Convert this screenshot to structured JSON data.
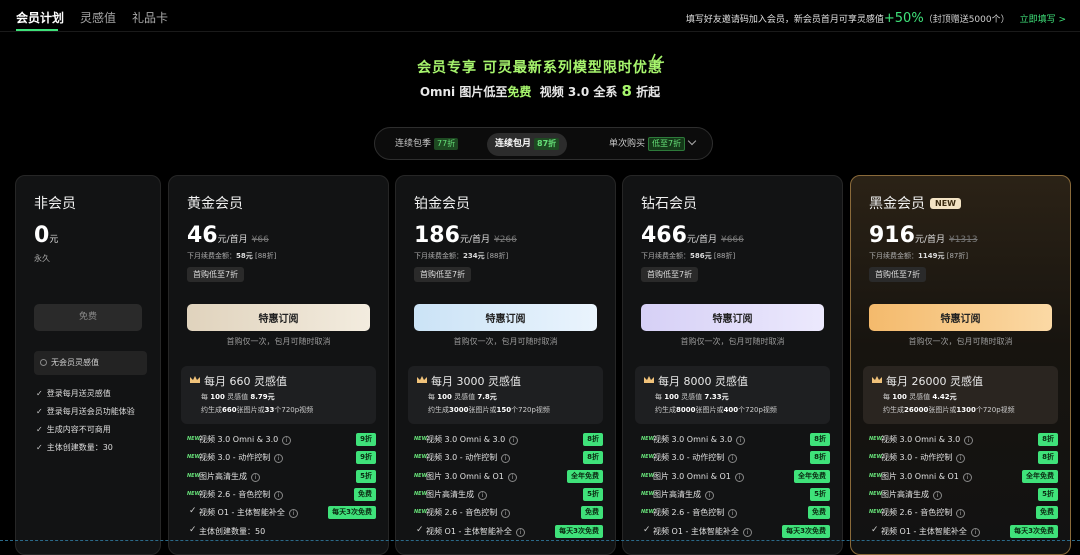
{
  "nav": {
    "tabs": [
      "会员计划",
      "灵感值",
      "礼品卡"
    ],
    "invite_text": "填写好友邀请码加入会员，新会员首月可享灵感值",
    "invite_bonus": "+50%",
    "invite_cap": "（封顶赠送5000个）",
    "invite_link": "立即填写 >"
  },
  "hero": {
    "line1": "会员专享 可灵最新系列模型限时优惠",
    "line2_a": "Omni 图片低至",
    "line2_free": "免费",
    "line2_b": "视频 3.0 全系",
    "line2_num": "8",
    "line2_c": "折起"
  },
  "billing": {
    "options": [
      {
        "label": "连续包季",
        "badge": "77折"
      },
      {
        "label": "连续包月",
        "badge": "87折"
      },
      {
        "label": "单次购买",
        "badge": "低至7折"
      }
    ],
    "selected_index": 1
  },
  "nonmember": {
    "name": "非会员",
    "price": "0",
    "unit": "元",
    "duration": "永久",
    "button": "免费",
    "credits": "无会员灵感值",
    "features": [
      "登录每月送灵感值",
      "登录每月送会员功能体验",
      "生成内容不可商用",
      "主体创建数量：30"
    ]
  },
  "plans": [
    {
      "name": "黄金会员",
      "new": "",
      "price": "46",
      "unit": "元/首月",
      "orig": "¥66",
      "renew_label": "下月续费金额：",
      "renew_price": "58元",
      "renew_disc": "[88折]",
      "first_tag": "首购低至7折",
      "cta": "特惠订阅",
      "cta_note": "首购仅一次，包月可随时取消",
      "credit_prefix": "每月",
      "credits": "660",
      "credit_unit": "灵感值",
      "per_price_a": "每",
      "per_price_b": "100",
      "per_price_c": "灵感值",
      "per_price_d": "8.79元",
      "gen_a": "约生成",
      "gen_imgs": "660",
      "gen_b": "张图片或",
      "gen_vids": "33",
      "gen_c": "个720p视频",
      "features": [
        {
          "new": "NEW",
          "label": "视频 3.0 Omni & 3.0",
          "info": "i",
          "badge": "9折"
        },
        {
          "new": "NEW",
          "label": "视频 3.0 - 动作控制",
          "info": "i",
          "badge": "9折"
        },
        {
          "new": "NEW",
          "label": "图片高清生成",
          "info": "i",
          "badge": "5折"
        },
        {
          "new": "NEW",
          "label": "视频 2.6 - 音色控制",
          "info": "i",
          "badge": "免费"
        },
        {
          "new": "",
          "label": "视频 O1 - 主体智能补全",
          "info": "i",
          "badge": "每天3次免费"
        },
        {
          "new": "",
          "label": "主体创建数量：50",
          "info": "",
          "badge": ""
        }
      ]
    },
    {
      "name": "铂金会员",
      "new": "",
      "price": "186",
      "unit": "元/首月",
      "orig": "¥266",
      "renew_label": "下月续费金额：",
      "renew_price": "234元",
      "renew_disc": "[88折]",
      "first_tag": "首购低至7折",
      "cta": "特惠订阅",
      "cta_note": "首购仅一次，包月可随时取消",
      "credit_prefix": "每月",
      "credits": "3000",
      "credit_unit": "灵感值",
      "per_price_a": "每",
      "per_price_b": "100",
      "per_price_c": "灵感值",
      "per_price_d": "7.8元",
      "gen_a": "约生成",
      "gen_imgs": "3000",
      "gen_b": "张图片或",
      "gen_vids": "150",
      "gen_c": "个720p视频",
      "features": [
        {
          "new": "NEW",
          "label": "视频 3.0 Omni & 3.0",
          "info": "i",
          "badge": "8折"
        },
        {
          "new": "NEW",
          "label": "视频 3.0 - 动作控制",
          "info": "i",
          "badge": "8折"
        },
        {
          "new": "NEW",
          "label": "图片 3.0 Omni & O1",
          "info": "i",
          "badge": "全年免费"
        },
        {
          "new": "NEW",
          "label": "图片高清生成",
          "info": "i",
          "badge": "5折"
        },
        {
          "new": "NEW",
          "label": "视频 2.6 - 音色控制",
          "info": "i",
          "badge": "免费"
        },
        {
          "new": "",
          "label": "视频 O1 - 主体智能补全",
          "info": "i",
          "badge": "每天3次免费"
        }
      ]
    },
    {
      "name": "钻石会员",
      "new": "",
      "price": "466",
      "unit": "元/首月",
      "orig": "¥666",
      "renew_label": "下月续费金额：",
      "renew_price": "586元",
      "renew_disc": "[88折]",
      "first_tag": "首购低至7折",
      "cta": "特惠订阅",
      "cta_note": "首购仅一次，包月可随时取消",
      "credit_prefix": "每月",
      "credits": "8000",
      "credit_unit": "灵感值",
      "per_price_a": "每",
      "per_price_b": "100",
      "per_price_c": "灵感值",
      "per_price_d": "7.33元",
      "gen_a": "约生成",
      "gen_imgs": "8000",
      "gen_b": "张图片或",
      "gen_vids": "400",
      "gen_c": "个720p视频",
      "features": [
        {
          "new": "NEW",
          "label": "视频 3.0 Omni & 3.0",
          "info": "i",
          "badge": "8折"
        },
        {
          "new": "NEW",
          "label": "视频 3.0 - 动作控制",
          "info": "i",
          "badge": "8折"
        },
        {
          "new": "NEW",
          "label": "图片 3.0 Omni & O1",
          "info": "i",
          "badge": "全年免费"
        },
        {
          "new": "NEW",
          "label": "图片高清生成",
          "info": "i",
          "badge": "5折"
        },
        {
          "new": "NEW",
          "label": "视频 2.6 - 音色控制",
          "info": "i",
          "badge": "免费"
        },
        {
          "new": "",
          "label": "视频 O1 - 主体智能补全",
          "info": "i",
          "badge": "每天3次免费"
        }
      ]
    },
    {
      "name": "黑金会员",
      "new": "NEW",
      "price": "916",
      "unit": "元/首月",
      "orig": "¥1313",
      "renew_label": "下月续费金额：",
      "renew_price": "1149元",
      "renew_disc": "[87折]",
      "first_tag": "首购低至7折",
      "cta": "特惠订阅",
      "cta_note": "首购仅一次，包月可随时取消",
      "credit_prefix": "每月",
      "credits": "26000",
      "credit_unit": "灵感值",
      "per_price_a": "每",
      "per_price_b": "100",
      "per_price_c": "灵感值",
      "per_price_d": "4.42元",
      "gen_a": "约生成",
      "gen_imgs": "26000",
      "gen_b": "张图片或",
      "gen_vids": "1300",
      "gen_c": "个720p视频",
      "features": [
        {
          "new": "NEW",
          "label": "视频 3.0 Omni & 3.0",
          "info": "i",
          "badge": "8折"
        },
        {
          "new": "NEW",
          "label": "视频 3.0 - 动作控制",
          "info": "i",
          "badge": "8折"
        },
        {
          "new": "NEW",
          "label": "图片 3.0 Omni & O1",
          "info": "i",
          "badge": "全年免费"
        },
        {
          "new": "NEW",
          "label": "图片高清生成",
          "info": "i",
          "badge": "5折"
        },
        {
          "new": "NEW",
          "label": "视频 2.6 - 音色控制",
          "info": "i",
          "badge": "免费"
        },
        {
          "new": "",
          "label": "视频 O1 - 主体智能补全",
          "info": "i",
          "badge": "每天3次免费"
        }
      ]
    }
  ]
}
